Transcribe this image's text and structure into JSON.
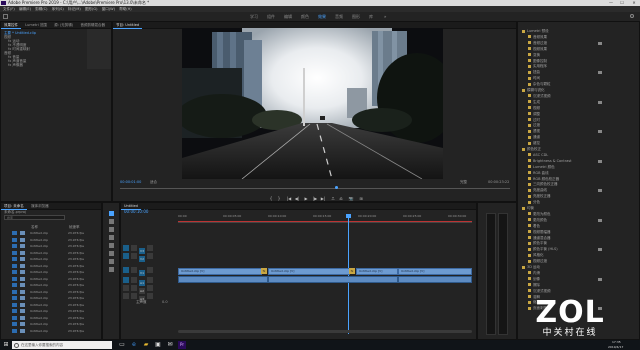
{
  "titlebar": {
    "title": "Adobe Premiere Pro 2019 - C:\\用户\\...\\Adobe\\Premiere Pro\\13.0\\未命名 *",
    "min_label": "—",
    "max_label": "☐",
    "close_label": "✕"
  },
  "menu": [
    "文件(F)",
    "编辑(E)",
    "剪辑(C)",
    "序列(S)",
    "标记(M)",
    "图形(G)",
    "窗口(W)",
    "帮助(H)"
  ],
  "workspaces": [
    {
      "label": "学习",
      "active": false
    },
    {
      "label": "组件",
      "active": false
    },
    {
      "label": "编辑",
      "active": false
    },
    {
      "label": "颜色",
      "active": false
    },
    {
      "label": "效果",
      "active": true
    },
    {
      "label": "音频",
      "active": false
    },
    {
      "label": "图形",
      "active": false
    },
    {
      "label": "库",
      "active": false
    }
  ],
  "source_panel": {
    "tabs": [
      "效果控件",
      "Lumetri 范围",
      "源: (无剪辑)",
      "音频剪辑混合器"
    ],
    "rows": [
      "主要 * Untitled.clip",
      "视频",
      "fx 运动",
      "fx 不透明度",
      "fx 时间重映射",
      "音频",
      "fx 音量",
      "fx 声道音量",
      "fx 声像器"
    ]
  },
  "program": {
    "tab_label": "节目: Untitled",
    "timecode_left": "00:00:01:00",
    "fit_label": "适合",
    "quality_label": "完整",
    "timecode_right": "00:00:23:22"
  },
  "transport_icons": [
    "mark-in",
    "mark-out",
    "go-to-in",
    "step-back",
    "play",
    "step-forward",
    "go-to-out",
    "lift",
    "extract",
    "export-frame",
    "comparison-view"
  ],
  "transport_glyphs": [
    "{",
    "}",
    "|◀",
    "◀|",
    "▶",
    "|▶",
    "▶|",
    "⎍",
    "⎌",
    "📷",
    "⊞"
  ],
  "project_panel": {
    "tabs": [
      "项目: 未命名",
      "媒体浏览器"
    ],
    "path_label": "未命名.prproj",
    "search_placeholder": "搜索",
    "headers": [
      "名称",
      "帧速率"
    ],
    "items": [
      {
        "name": "Untitled.clip",
        "rate": "23.976 fps"
      },
      {
        "name": "Untitled.clip",
        "rate": "23.976 fps"
      },
      {
        "name": "Untitled.clip",
        "rate": "23.976 fps"
      },
      {
        "name": "Untitled.clip",
        "rate": "23.976 fps"
      },
      {
        "name": "Untitled.clip",
        "rate": "23.976 fps"
      },
      {
        "name": "Untitled.clip",
        "rate": "23.976 fps"
      },
      {
        "name": "Untitled.clip",
        "rate": "23.976 fps"
      },
      {
        "name": "Untitled.clip",
        "rate": "23.976 fps"
      },
      {
        "name": "Untitled.clip",
        "rate": "23.976 fps"
      },
      {
        "name": "Untitled.clip",
        "rate": "23.976 fps"
      },
      {
        "name": "Untitled.clip",
        "rate": "23.976 fps"
      },
      {
        "name": "Untitled.clip",
        "rate": "23.976 fps"
      },
      {
        "name": "Untitled.clip",
        "rate": "23.976 fps"
      },
      {
        "name": "Untitled.clip",
        "rate": "23.976 fps"
      },
      {
        "name": "Untitled.clip",
        "rate": "23.976 fps"
      },
      {
        "name": "Untitled.clip",
        "rate": "23.976 fps"
      }
    ]
  },
  "timeline": {
    "tab_label": "Untitled",
    "timecode": "00:00:10:00",
    "ruler": [
      "00:00",
      "00:00:05:00",
      "00:00:10:00",
      "00:00:15:00",
      "00:00:20:00",
      "00:00:25:00",
      "00:00:30:00"
    ],
    "tracks_video": [
      "V3",
      "V2",
      "V1"
    ],
    "tracks_audio": [
      "A1",
      "A2",
      "A3"
    ],
    "master_label": "主声道",
    "master_value": "0.0",
    "clips": [
      {
        "label": "Untitled.clip [V]"
      },
      {
        "label": "Untitled.clip [V]"
      },
      {
        "label": "Untitled.clip [V]"
      },
      {
        "label": "Untitled.clip [V]"
      }
    ]
  },
  "effects_panel": {
    "rows": [
      "Lumetri 预设",
      "音频效果",
      "音频过渡",
      "视频效果",
      "变换",
      "图像控制",
      "实用程序",
      "扭曲",
      "时间",
      "杂色与颗粒",
      "模糊与锐化",
      "沉浸式视频",
      "生成",
      "视频",
      "调整",
      "过时",
      "过渡",
      "透视",
      "通道",
      "键控",
      "颜色校正",
      "ASC CDL",
      "Brightness & Contrast",
      "Lumetri 颜色",
      "RGB 曲线",
      "RGB 颜色校正器",
      "三向颜色校正器",
      "亮度曲线",
      "亮度校正器",
      "分色",
      "均衡",
      "更改为颜色",
      "更改颜色",
      "着色",
      "视频限幅器",
      "通道混合器",
      "颜色平衡",
      "颜色平衡 (HLS)",
      "风格化",
      "视频过渡",
      "3D 运动",
      "内滑",
      "划像",
      "擦除",
      "沉浸式视频",
      "溶解",
      "缩放",
      "页面剥落"
    ]
  },
  "watermark": {
    "brand": "ZOL",
    "subtitle": "中关村在线"
  },
  "taskbar": {
    "search_placeholder": "在这里输入你要搜索的内容",
    "time": "17:35",
    "date": "2019/4/17"
  },
  "colors": {
    "accent": "#4aa3ff",
    "video_clip": "#6d9bd1",
    "audio_clip": "#5d8bc2",
    "fx_badge": "#c9a743"
  }
}
